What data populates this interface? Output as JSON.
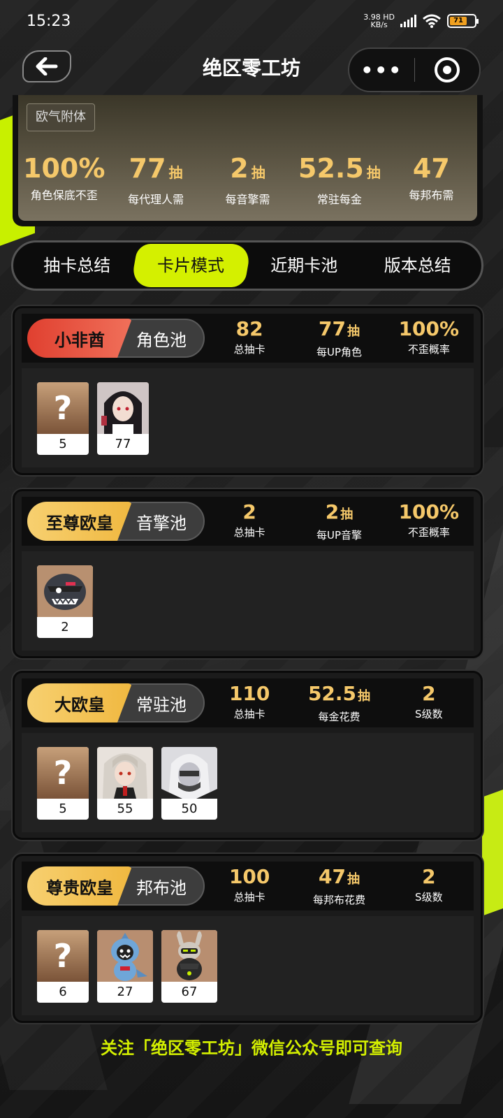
{
  "status": {
    "time": "15:23",
    "net_speed_top": "3.98 HD",
    "net_speed_bottom": "KB/s",
    "battery": "71"
  },
  "nav": {
    "title": "绝区零工坊",
    "more_icon": "more-dots-icon",
    "target_icon": "target-icon"
  },
  "summary": {
    "tag": "欧气附体",
    "stats": [
      {
        "value": "100%",
        "unit": "",
        "label": "角色保底不歪"
      },
      {
        "value": "77",
        "unit": "抽",
        "label": "每代理人需"
      },
      {
        "value": "2",
        "unit": "抽",
        "label": "每音擎需"
      },
      {
        "value": "52.5",
        "unit": "抽",
        "label": "常驻每金"
      },
      {
        "value": "47",
        "unit": "",
        "label": "每邦布需"
      }
    ]
  },
  "tabs": [
    "抽卡总结",
    "卡片模式",
    "近期卡池",
    "版本总结"
  ],
  "active_tab": 1,
  "pools": [
    {
      "badge": "小非酋",
      "badge_style": "red",
      "name": "角色池",
      "stats": [
        {
          "value": "82",
          "unit": "",
          "label": "总抽卡"
        },
        {
          "value": "77",
          "unit": "抽",
          "label": "每UP角色"
        },
        {
          "value": "100%",
          "unit": "",
          "label": "不歪概率"
        }
      ],
      "chars": [
        {
          "type": "unknown",
          "mark": "?",
          "count": "5"
        },
        {
          "type": "portrait",
          "icon": "agent-portrait-dark-hair",
          "count": "77"
        }
      ]
    },
    {
      "badge": "至尊欧皇",
      "badge_style": "gold",
      "name": "音擎池",
      "stats": [
        {
          "value": "2",
          "unit": "",
          "label": "总抽卡"
        },
        {
          "value": "2",
          "unit": "抽",
          "label": "每UP音擎"
        },
        {
          "value": "100%",
          "unit": "",
          "label": "不歪概率"
        }
      ],
      "chars": [
        {
          "type": "portrait",
          "icon": "shark-engine-icon",
          "count": "2"
        }
      ]
    },
    {
      "badge": "大欧皇",
      "badge_style": "gold",
      "name": "常驻池",
      "stats": [
        {
          "value": "110",
          "unit": "",
          "label": "总抽卡"
        },
        {
          "value": "52.5",
          "unit": "抽",
          "label": "每金花费"
        },
        {
          "value": "2",
          "unit": "",
          "label": "S级数"
        }
      ],
      "chars": [
        {
          "type": "unknown",
          "mark": "?",
          "count": "5"
        },
        {
          "type": "portrait",
          "icon": "agent-portrait-white-hair",
          "count": "55"
        },
        {
          "type": "portrait",
          "icon": "agent-portrait-masked",
          "count": "50"
        }
      ]
    },
    {
      "badge": "尊贵欧皇",
      "badge_style": "gold",
      "name": "邦布池",
      "stats": [
        {
          "value": "100",
          "unit": "",
          "label": "总抽卡"
        },
        {
          "value": "47",
          "unit": "抽",
          "label": "每邦布花费"
        },
        {
          "value": "2",
          "unit": "",
          "label": "S级数"
        }
      ],
      "chars": [
        {
          "type": "unknown",
          "mark": "?",
          "count": "6"
        },
        {
          "type": "portrait",
          "icon": "bangboo-shark-icon",
          "count": "27"
        },
        {
          "type": "portrait",
          "icon": "bangboo-rabbit-icon",
          "count": "67"
        }
      ]
    }
  ],
  "footer": "关注「绝区零工坊」微信公众号即可查询"
}
